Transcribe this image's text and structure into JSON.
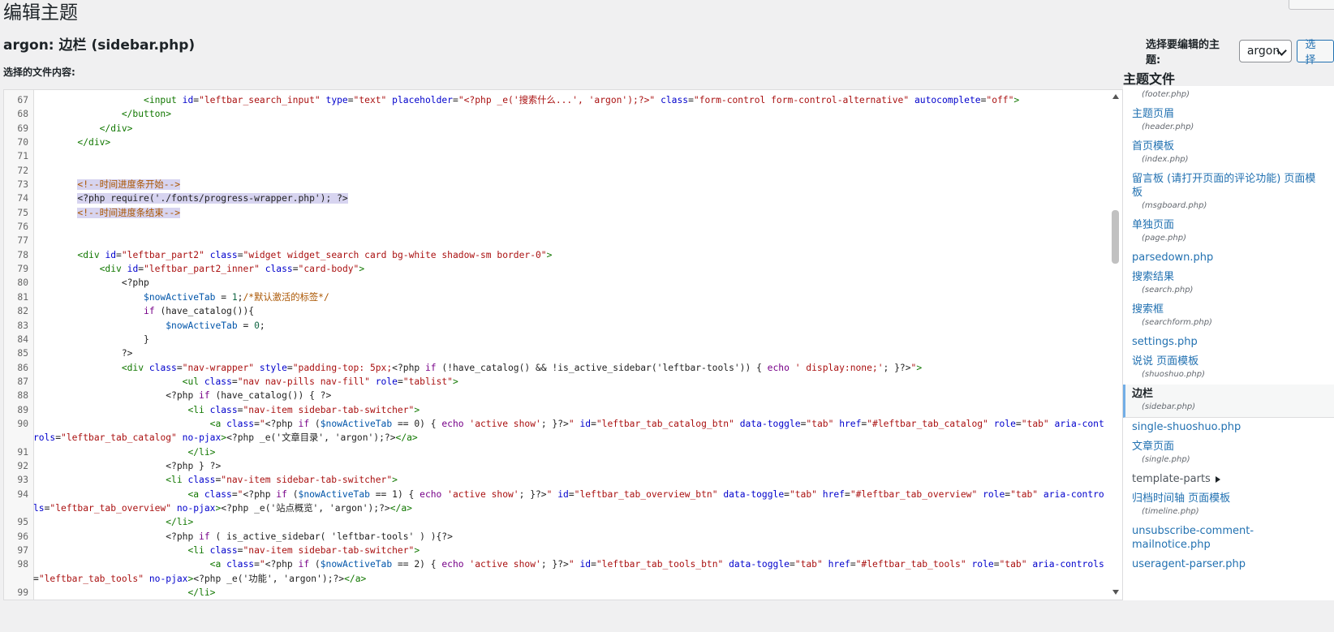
{
  "page": {
    "title": "编辑主题",
    "file_heading_theme": "argon: ",
    "file_heading_name": "边栏",
    "file_heading_file": " (sidebar.php)",
    "select_theme_label": "选择要编辑的主题:",
    "select_theme_value": "argon",
    "select_button": "选择",
    "content_label": "选择的文件内容:"
  },
  "files_panel": {
    "title": "主题文件",
    "files": [
      {
        "name": "",
        "path": "(footer.php)"
      },
      {
        "name": "主题页眉",
        "path": "(header.php)"
      },
      {
        "name": "首页模板",
        "path": "(index.php)"
      },
      {
        "name": "留言板 (请打开页面的评论功能) 页面模板",
        "path": "(msgboard.php)"
      },
      {
        "name": "单独页面",
        "path": "(page.php)"
      },
      {
        "name": "parsedown.php",
        "path": ""
      },
      {
        "name": "搜索结果",
        "path": "(search.php)"
      },
      {
        "name": "搜索框",
        "path": "(searchform.php)"
      },
      {
        "name": "settings.php",
        "path": ""
      },
      {
        "name": "说说 页面模板",
        "path": "(shuoshuo.php)"
      },
      {
        "name": "边栏",
        "path": "(sidebar.php)",
        "active": true
      },
      {
        "name": "single-shuoshuo.php",
        "path": ""
      },
      {
        "name": "文章页面",
        "path": "(single.php)"
      },
      {
        "name": "template-parts",
        "path": "",
        "folder": true
      },
      {
        "name": "归档时间轴 页面模板",
        "path": "(timeline.php)"
      },
      {
        "name": "unsubscribe-comment-mailnotice.php",
        "path": ""
      },
      {
        "name": "useragent-parser.php",
        "path": ""
      }
    ]
  },
  "editor": {
    "line_numbers": [
      "67",
      "68",
      "69",
      "70",
      "71",
      "72",
      "73",
      "74",
      "75",
      "76",
      "77",
      "78",
      "79",
      "80",
      "81",
      "82",
      "83",
      "84",
      "85",
      "86",
      "87",
      "88",
      "89",
      "90",
      "91",
      "92",
      "93",
      "94",
      "95",
      "96",
      "97",
      "98",
      "99"
    ],
    "highlighted_lines": [
      "73",
      "74",
      "75"
    ],
    "wrapped_lines": [
      "90",
      "94",
      "98"
    ],
    "lines": [
      [
        [
          "",
          "                    "
        ],
        [
          "tg",
          "<input "
        ],
        [
          "at",
          "id"
        ],
        [
          "pl",
          "="
        ],
        [
          "st",
          "\"leftbar_search_input\""
        ],
        [
          "pl",
          " "
        ],
        [
          "at",
          "type"
        ],
        [
          "pl",
          "="
        ],
        [
          "st",
          "\"text\""
        ],
        [
          "pl",
          " "
        ],
        [
          "at",
          "placeholder"
        ],
        [
          "pl",
          "="
        ],
        [
          "st",
          "\"<?php _e('搜索什么...', 'argon');?>\""
        ],
        [
          "pl",
          " "
        ],
        [
          "at",
          "class"
        ],
        [
          "pl",
          "="
        ],
        [
          "st",
          "\"form-control form-control-alternative\""
        ],
        [
          "pl",
          " "
        ],
        [
          "at",
          "autocomplete"
        ],
        [
          "pl",
          "="
        ],
        [
          "st",
          "\"off\""
        ],
        [
          "tg",
          ">"
        ]
      ],
      [
        [
          "",
          "                "
        ],
        [
          "tg",
          "</button>"
        ]
      ],
      [
        [
          "",
          "            "
        ],
        [
          "tg",
          "</div>"
        ]
      ],
      [
        [
          "",
          "        "
        ],
        [
          "tg",
          "</div>"
        ]
      ],
      [
        [
          "",
          ""
        ]
      ],
      [
        [
          "",
          ""
        ]
      ],
      [
        [
          "",
          "        "
        ],
        [
          "cm",
          "<!--时间进度条开始-->"
        ]
      ],
      [
        [
          "",
          "        "
        ],
        [
          "pl",
          "<?php require('./fonts/progress-wrapper.php'); ?>"
        ]
      ],
      [
        [
          "",
          "        "
        ],
        [
          "cm",
          "<!--时间进度条结束-->"
        ]
      ],
      [
        [
          "",
          ""
        ]
      ],
      [
        [
          "",
          ""
        ]
      ],
      [
        [
          "",
          "        "
        ],
        [
          "tg",
          "<div "
        ],
        [
          "at",
          "id"
        ],
        [
          "pl",
          "="
        ],
        [
          "st",
          "\"leftbar_part2\""
        ],
        [
          "pl",
          " "
        ],
        [
          "at",
          "class"
        ],
        [
          "pl",
          "="
        ],
        [
          "st",
          "\"widget widget_search card bg-white shadow-sm border-0\""
        ],
        [
          "tg",
          ">"
        ]
      ],
      [
        [
          "",
          "            "
        ],
        [
          "tg",
          "<div "
        ],
        [
          "at",
          "id"
        ],
        [
          "pl",
          "="
        ],
        [
          "st",
          "\"leftbar_part2_inner\""
        ],
        [
          "pl",
          " "
        ],
        [
          "at",
          "class"
        ],
        [
          "pl",
          "="
        ],
        [
          "st",
          "\"card-body\""
        ],
        [
          "tg",
          ">"
        ]
      ],
      [
        [
          "",
          "                "
        ],
        [
          "pl",
          "<?php"
        ]
      ],
      [
        [
          "",
          "                    "
        ],
        [
          "vr",
          "$nowActiveTab"
        ],
        [
          "pl",
          " = "
        ],
        [
          "nm",
          "1"
        ],
        [
          "pl",
          ";"
        ],
        [
          "cm",
          "/*默认激活的标签*/"
        ]
      ],
      [
        [
          "",
          "                    "
        ],
        [
          "kw",
          "if"
        ],
        [
          "pl",
          " (have_catalog()){"
        ]
      ],
      [
        [
          "",
          "                        "
        ],
        [
          "vr",
          "$nowActiveTab"
        ],
        [
          "pl",
          " = "
        ],
        [
          "nm",
          "0"
        ],
        [
          "pl",
          ";"
        ]
      ],
      [
        [
          "",
          "                    "
        ],
        [
          "pl",
          "}"
        ]
      ],
      [
        [
          "",
          "                "
        ],
        [
          "pl",
          "?>"
        ]
      ],
      [
        [
          "",
          "                "
        ],
        [
          "tg",
          "<div "
        ],
        [
          "at",
          "class"
        ],
        [
          "pl",
          "="
        ],
        [
          "st",
          "\"nav-wrapper\""
        ],
        [
          "pl",
          " "
        ],
        [
          "at",
          "style"
        ],
        [
          "pl",
          "="
        ],
        [
          "st",
          "\"padding-top: 5px;"
        ],
        [
          "pl",
          "<?php "
        ],
        [
          "kw",
          "if"
        ],
        [
          "pl",
          " (!have_catalog() && !is_active_sidebar('leftbar-tools')) { "
        ],
        [
          "kw",
          "echo"
        ],
        [
          "st",
          " ' display:none;'"
        ],
        [
          "pl",
          "; }?>"
        ],
        [
          "st",
          "\""
        ],
        [
          "tg",
          ">"
        ]
      ],
      [
        [
          "",
          "                           "
        ],
        [
          "tg",
          "<ul "
        ],
        [
          "at",
          "class"
        ],
        [
          "pl",
          "="
        ],
        [
          "st",
          "\"nav nav-pills nav-fill\""
        ],
        [
          "pl",
          " "
        ],
        [
          "at",
          "role"
        ],
        [
          "pl",
          "="
        ],
        [
          "st",
          "\"tablist\""
        ],
        [
          "tg",
          ">"
        ]
      ],
      [
        [
          "",
          "                        "
        ],
        [
          "pl",
          "<?php "
        ],
        [
          "kw",
          "if"
        ],
        [
          "pl",
          " (have_catalog()) { ?>"
        ]
      ],
      [
        [
          "",
          "                            "
        ],
        [
          "tg",
          "<li "
        ],
        [
          "at",
          "class"
        ],
        [
          "pl",
          "="
        ],
        [
          "st",
          "\"nav-item sidebar-tab-switcher\""
        ],
        [
          "tg",
          ">"
        ]
      ],
      [
        [
          "",
          "                                "
        ],
        [
          "tg",
          "<a "
        ],
        [
          "at",
          "class"
        ],
        [
          "pl",
          "="
        ],
        [
          "st",
          "\""
        ],
        [
          "pl",
          "<?php "
        ],
        [
          "kw",
          "if"
        ],
        [
          "pl",
          " ("
        ],
        [
          "vr",
          "$nowActiveTab"
        ],
        [
          "pl",
          " == 0) { "
        ],
        [
          "kw",
          "echo"
        ],
        [
          "st",
          " 'active show'"
        ],
        [
          "pl",
          "; }?>"
        ],
        [
          "st",
          "\""
        ],
        [
          "pl",
          " "
        ],
        [
          "at",
          "id"
        ],
        [
          "pl",
          "="
        ],
        [
          "st",
          "\"leftbar_tab_catalog_btn\""
        ],
        [
          "pl",
          " "
        ],
        [
          "at",
          "data-toggle"
        ],
        [
          "pl",
          "="
        ],
        [
          "st",
          "\"tab\""
        ],
        [
          "pl",
          " "
        ],
        [
          "at",
          "href"
        ],
        [
          "pl",
          "="
        ],
        [
          "st",
          "\"#leftbar_tab_catalog\""
        ],
        [
          "pl",
          " "
        ],
        [
          "at",
          "role"
        ],
        [
          "pl",
          "="
        ],
        [
          "st",
          "\"tab\""
        ],
        [
          "pl",
          " "
        ],
        [
          "at",
          "aria-controls"
        ],
        [
          "pl",
          "="
        ],
        [
          "st",
          "\"leftbar_tab_catalog\""
        ],
        [
          "pl",
          " "
        ],
        [
          "at",
          "no-pjax"
        ],
        [
          "tg",
          ">"
        ],
        [
          "pl",
          "<?php _e('文章目录', 'argon');?>"
        ],
        [
          "tg",
          "</a>"
        ]
      ],
      [
        [
          "",
          "                            "
        ],
        [
          "tg",
          "</li>"
        ]
      ],
      [
        [
          "",
          "                        "
        ],
        [
          "pl",
          "<?php } ?>"
        ]
      ],
      [
        [
          "",
          "                        "
        ],
        [
          "tg",
          "<li "
        ],
        [
          "at",
          "class"
        ],
        [
          "pl",
          "="
        ],
        [
          "st",
          "\"nav-item sidebar-tab-switcher\""
        ],
        [
          "tg",
          ">"
        ]
      ],
      [
        [
          "",
          "                            "
        ],
        [
          "tg",
          "<a "
        ],
        [
          "at",
          "class"
        ],
        [
          "pl",
          "="
        ],
        [
          "st",
          "\""
        ],
        [
          "pl",
          "<?php "
        ],
        [
          "kw",
          "if"
        ],
        [
          "pl",
          " ("
        ],
        [
          "vr",
          "$nowActiveTab"
        ],
        [
          "pl",
          " == 1) { "
        ],
        [
          "kw",
          "echo"
        ],
        [
          "st",
          " 'active show'"
        ],
        [
          "pl",
          "; }?>"
        ],
        [
          "st",
          "\""
        ],
        [
          "pl",
          " "
        ],
        [
          "at",
          "id"
        ],
        [
          "pl",
          "="
        ],
        [
          "st",
          "\"leftbar_tab_overview_btn\""
        ],
        [
          "pl",
          " "
        ],
        [
          "at",
          "data-toggle"
        ],
        [
          "pl",
          "="
        ],
        [
          "st",
          "\"tab\""
        ],
        [
          "pl",
          " "
        ],
        [
          "at",
          "href"
        ],
        [
          "pl",
          "="
        ],
        [
          "st",
          "\"#leftbar_tab_overview\""
        ],
        [
          "pl",
          " "
        ],
        [
          "at",
          "role"
        ],
        [
          "pl",
          "="
        ],
        [
          "st",
          "\"tab\""
        ],
        [
          "pl",
          " "
        ],
        [
          "at",
          "aria-controls"
        ],
        [
          "pl",
          "="
        ],
        [
          "st",
          "\"leftbar_tab_overview\""
        ],
        [
          "pl",
          " "
        ],
        [
          "at",
          "no-pjax"
        ],
        [
          "tg",
          ">"
        ],
        [
          "pl",
          "<?php _e('站点概览', 'argon');?>"
        ],
        [
          "tg",
          "</a>"
        ]
      ],
      [
        [
          "",
          "                        "
        ],
        [
          "tg",
          "</li>"
        ]
      ],
      [
        [
          "",
          "                        "
        ],
        [
          "pl",
          "<?php "
        ],
        [
          "kw",
          "if"
        ],
        [
          "pl",
          " ( is_active_sidebar( 'leftbar-tools' ) ){?>"
        ]
      ],
      [
        [
          "",
          "                            "
        ],
        [
          "tg",
          "<li "
        ],
        [
          "at",
          "class"
        ],
        [
          "pl",
          "="
        ],
        [
          "st",
          "\"nav-item sidebar-tab-switcher\""
        ],
        [
          "tg",
          ">"
        ]
      ],
      [
        [
          "",
          "                                "
        ],
        [
          "tg",
          "<a "
        ],
        [
          "at",
          "class"
        ],
        [
          "pl",
          "="
        ],
        [
          "st",
          "\""
        ],
        [
          "pl",
          "<?php "
        ],
        [
          "kw",
          "if"
        ],
        [
          "pl",
          " ("
        ],
        [
          "vr",
          "$nowActiveTab"
        ],
        [
          "pl",
          " == 2) { "
        ],
        [
          "kw",
          "echo"
        ],
        [
          "st",
          " 'active show'"
        ],
        [
          "pl",
          "; }?>"
        ],
        [
          "st",
          "\""
        ],
        [
          "pl",
          " "
        ],
        [
          "at",
          "id"
        ],
        [
          "pl",
          "="
        ],
        [
          "st",
          "\"leftbar_tab_tools_btn\""
        ],
        [
          "pl",
          " "
        ],
        [
          "at",
          "data-toggle"
        ],
        [
          "pl",
          "="
        ],
        [
          "st",
          "\"tab\""
        ],
        [
          "pl",
          " "
        ],
        [
          "at",
          "href"
        ],
        [
          "pl",
          "="
        ],
        [
          "st",
          "\"#leftbar_tab_tools\""
        ],
        [
          "pl",
          " "
        ],
        [
          "at",
          "role"
        ],
        [
          "pl",
          "="
        ],
        [
          "st",
          "\"tab\""
        ],
        [
          "pl",
          " "
        ],
        [
          "at",
          "aria-controls"
        ],
        [
          "pl",
          "="
        ],
        [
          "st",
          "\"leftbar_tab_tools\""
        ],
        [
          "pl",
          " "
        ],
        [
          "at",
          "no-pjax"
        ],
        [
          "tg",
          ">"
        ],
        [
          "pl",
          "<?php _e('功能', 'argon');?>"
        ],
        [
          "tg",
          "</a>"
        ]
      ],
      [
        [
          "",
          "                            "
        ],
        [
          "tg",
          "</li>"
        ]
      ]
    ]
  }
}
